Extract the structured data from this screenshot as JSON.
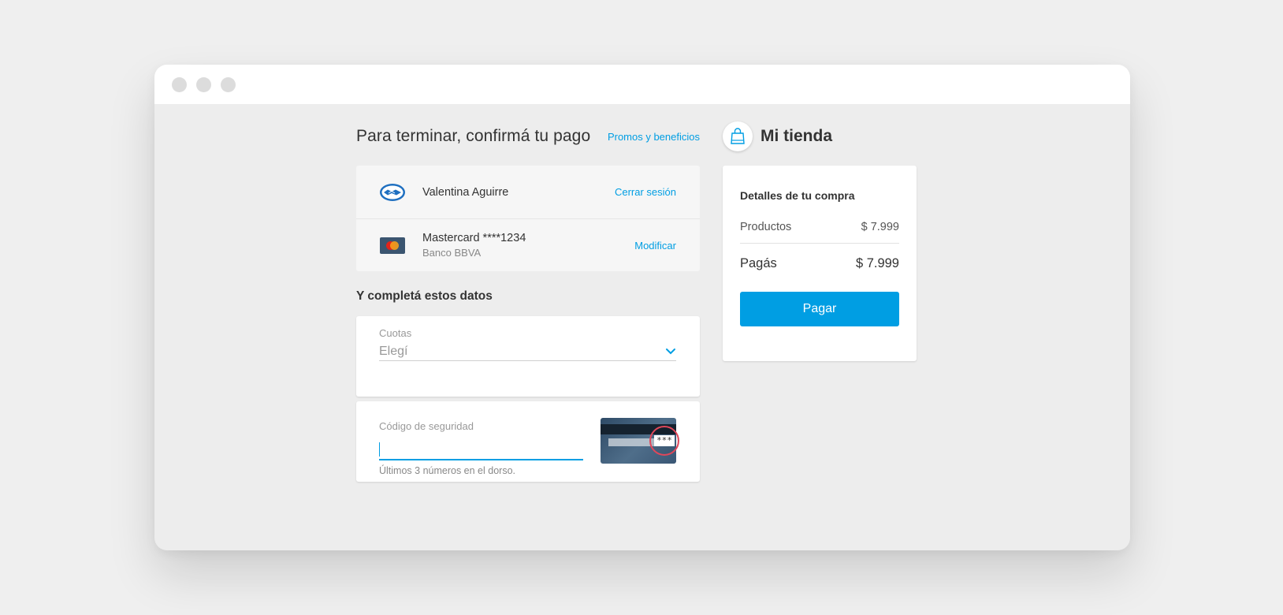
{
  "window": {
    "controls": [
      "close",
      "minimize",
      "maximize"
    ]
  },
  "checkout": {
    "title": "Para terminar, confirmá tu pago",
    "promos_link": "Promos y beneficios",
    "account": {
      "icon": "mercadopago-handshake-icon",
      "name": "Valentina Aguirre",
      "action": "Cerrar sesión"
    },
    "payment_method": {
      "icon": "mastercard-icon",
      "name": "Mastercard ****1234",
      "bank": "Banco BBVA",
      "action": "Modificar"
    },
    "section_title": "Y completá estos datos",
    "installments": {
      "label": "Cuotas",
      "value": "Elegí"
    },
    "security_code": {
      "label": "Código de seguridad",
      "value": "",
      "hint": "Últimos 3 números en el dorso.",
      "sample": "***"
    }
  },
  "store": {
    "name": "Mi tienda",
    "icon": "shopping-bag-icon",
    "summary": {
      "title": "Detalles de tu compra",
      "products_label": "Productos",
      "products_value": "$ 7.999",
      "total_label": "Pagás",
      "total_value": "$ 7.999",
      "pay_button": "Pagar"
    }
  },
  "colors": {
    "accent": "#009ee3",
    "highlight": "#e0475a",
    "background": "#efefef"
  }
}
